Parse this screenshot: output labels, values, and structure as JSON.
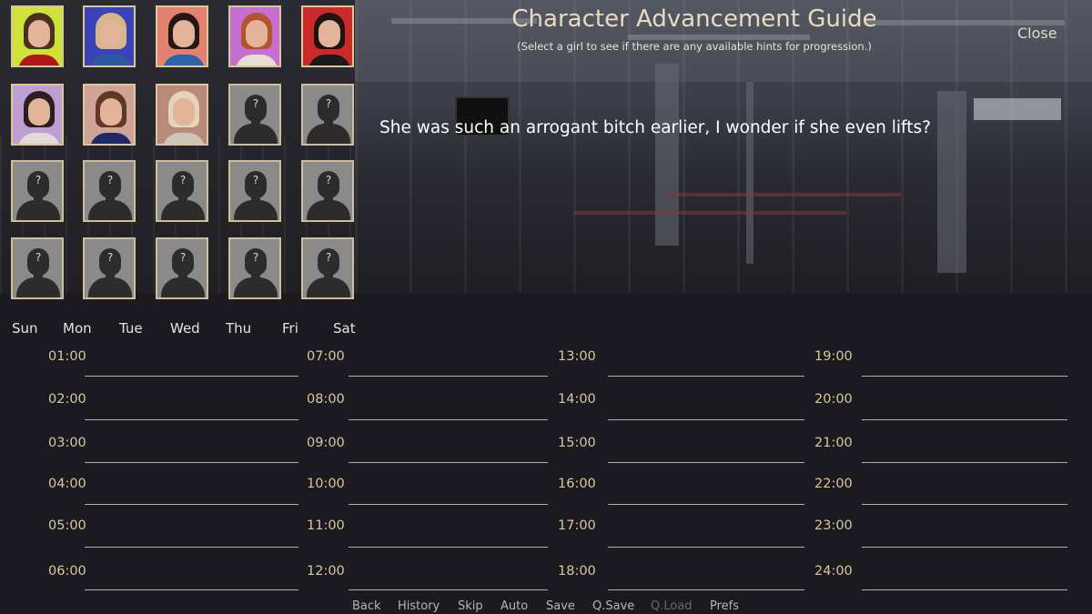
{
  "header": {
    "title": "Character Advancement Guide",
    "subtitle": "(Select a girl to see if there are any available hints for progression.)",
    "close_label": "Close"
  },
  "hint_text": "She was such an arrogant bitch earlier, I wonder if she even lifts?",
  "characters": [
    {
      "state": "unlocked",
      "bg": "#cfe23a",
      "hair": "#4a3020",
      "top": "#b01818"
    },
    {
      "state": "unlocked",
      "bg": "#3a44b8",
      "hair": "#d7b78a",
      "top": "#2b5aa0"
    },
    {
      "state": "unlocked",
      "bg": "#e2826e",
      "hair": "#231816",
      "top": "#2b64a8"
    },
    {
      "state": "unlocked",
      "bg": "#c76fd0",
      "hair": "#b2552e",
      "top": "#e7ddd2"
    },
    {
      "state": "unlocked",
      "bg": "#cc2a2a",
      "hair": "#1e1512",
      "top": "#1a1a1a"
    },
    {
      "state": "unlocked",
      "bg": "#bf9ed4",
      "hair": "#2a1e1e",
      "top": "#e4dada"
    },
    {
      "state": "unlocked",
      "bg": "#cfa496",
      "hair": "#5c3a26",
      "top": "#1d2a66"
    },
    {
      "state": "unlocked",
      "bg": "#b98a7c",
      "hair": "#e6d4b6",
      "top": "#cfc4b8"
    },
    {
      "state": "locked",
      "label": "?"
    },
    {
      "state": "locked",
      "label": "?"
    },
    {
      "state": "locked",
      "label": "?"
    },
    {
      "state": "locked",
      "label": "?"
    },
    {
      "state": "locked",
      "label": "?"
    },
    {
      "state": "locked",
      "label": "?"
    },
    {
      "state": "locked",
      "label": "?"
    },
    {
      "state": "locked",
      "label": "?"
    },
    {
      "state": "locked",
      "label": "?"
    },
    {
      "state": "locked",
      "label": "?"
    },
    {
      "state": "locked",
      "label": "?"
    },
    {
      "state": "locked",
      "label": "?"
    }
  ],
  "days": [
    "Sun",
    "Mon",
    "Tue",
    "Wed",
    "Thu",
    "Fri",
    "Sat"
  ],
  "schedule": [
    [
      "01:00",
      "02:00",
      "03:00",
      "04:00",
      "05:00",
      "06:00"
    ],
    [
      "07:00",
      "08:00",
      "09:00",
      "10:00",
      "11:00",
      "12:00"
    ],
    [
      "13:00",
      "14:00",
      "15:00",
      "16:00",
      "17:00",
      "18:00"
    ],
    [
      "19:00",
      "20:00",
      "21:00",
      "22:00",
      "23:00",
      "24:00"
    ]
  ],
  "quick_menu": [
    {
      "label": "Back",
      "enabled": true
    },
    {
      "label": "History",
      "enabled": true
    },
    {
      "label": "Skip",
      "enabled": true
    },
    {
      "label": "Auto",
      "enabled": true
    },
    {
      "label": "Save",
      "enabled": true
    },
    {
      "label": "Q.Save",
      "enabled": true
    },
    {
      "label": "Q.Load",
      "enabled": false
    },
    {
      "label": "Prefs",
      "enabled": true
    }
  ]
}
